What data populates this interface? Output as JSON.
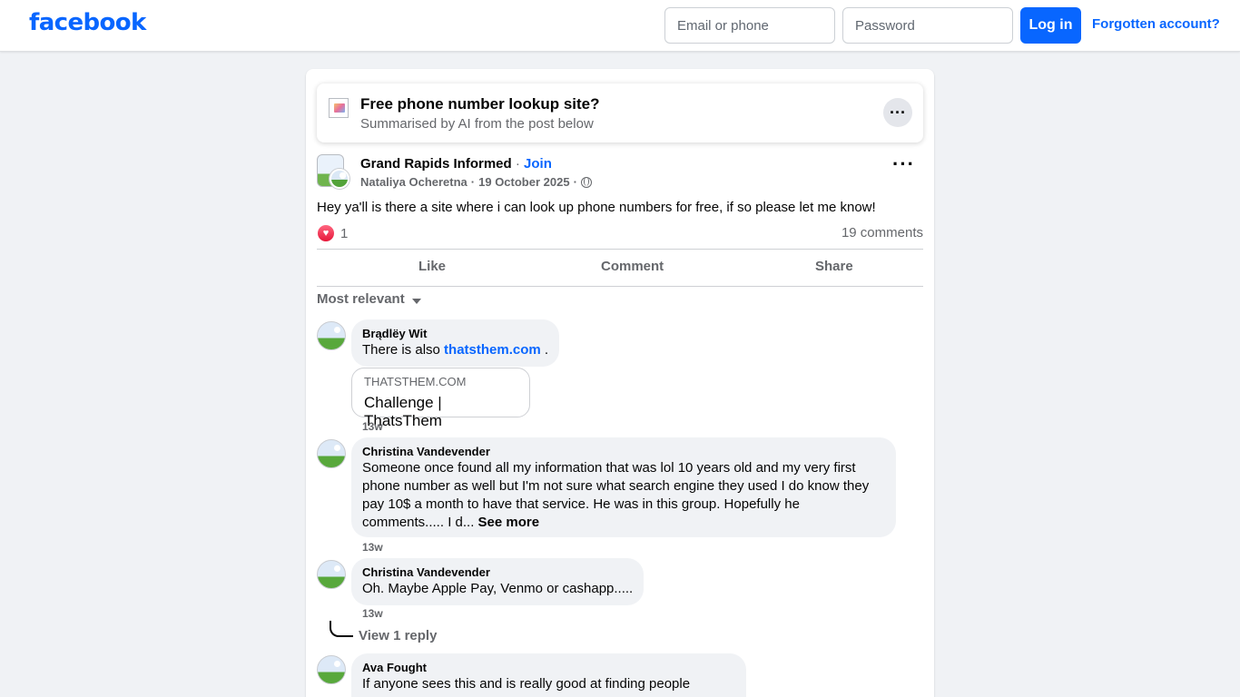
{
  "header": {
    "logo": "facebook",
    "email_placeholder": "Email or phone",
    "password_placeholder": "Password",
    "login_label": "Log in",
    "forgot_label": "Forgotten account?"
  },
  "ai_summary": {
    "title": "Free phone number lookup site?",
    "subtitle": "Summarised by AI from the post below",
    "more_label": "···"
  },
  "post": {
    "group_name": "Grand Rapids Informed",
    "separator": " · ",
    "join_label": "Join",
    "author": "Nataliya Ocheretna",
    "date": "19 October 2025",
    "meta_separator": " · ",
    "more_label": "···",
    "text": "Hey ya'll is there a site where i can look up phone numbers for free, if so please let me know!",
    "reaction_icon": "love-icon",
    "reaction_count": "1",
    "comment_count": "19 comments"
  },
  "actions": {
    "like": "Like",
    "comment": "Comment",
    "share": "Share"
  },
  "sort_label": "Most relevant",
  "comments": [
    {
      "author": "Brądlëy Wit",
      "text_before": "There is also ",
      "link_text": "thatsthem.com",
      "text_after": " .",
      "preview_domain": "THATSTHEM.COM",
      "preview_title": "Challenge | ThatsThem",
      "time": "13w"
    },
    {
      "author": "Christina Vandevender",
      "text": "Someone once found all my information that was lol 10 years old and my very first phone number as well but I'm not sure what search engine they used I do know they pay 10$ a month to have that service. He was in this group. Hopefully he comments..... I d... ",
      "see_more": "See more",
      "time": "13w"
    },
    {
      "author": "Christina Vandevender",
      "text": "Oh. Maybe Apple Pay, Venmo or cashapp.....",
      "time": "13w",
      "view_replies": "View 1 reply"
    },
    {
      "author": "Ava Fought",
      "text": "If anyone sees this and is really good at finding people"
    }
  ]
}
